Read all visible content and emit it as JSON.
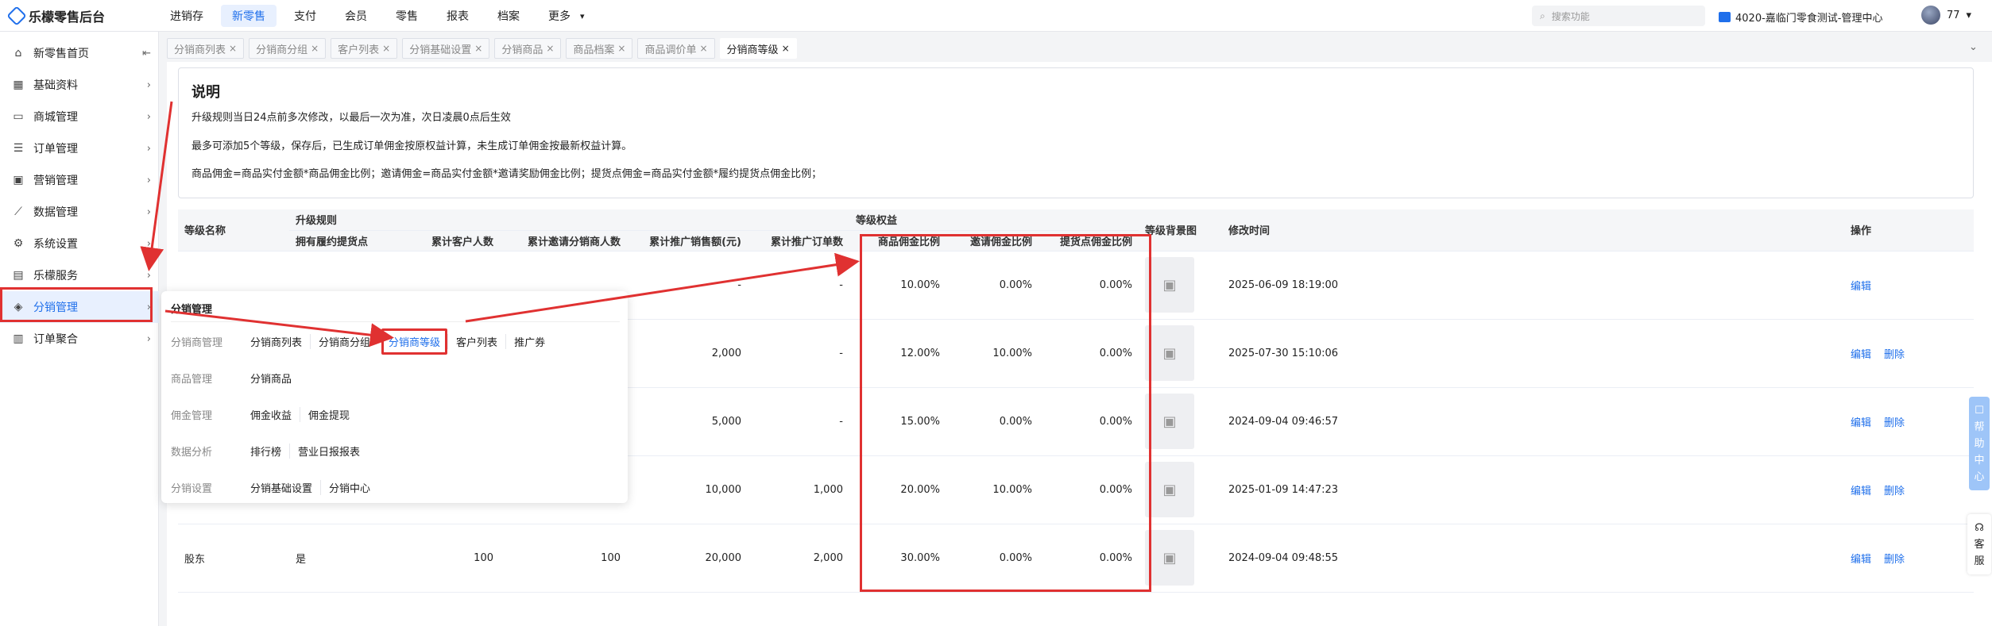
{
  "app": {
    "title": "乐檬零售后台"
  },
  "topnav": [
    "进销存",
    "新零售",
    "支付",
    "会员",
    "零售",
    "报表",
    "档案",
    "更多"
  ],
  "topnav_active_index": 1,
  "search": {
    "placeholder": "搜索功能"
  },
  "store": {
    "label": "4020-嘉临门零食测试-管理中心"
  },
  "user": {
    "name": "77"
  },
  "sidebar": {
    "collapse_icon": "collapse-icon",
    "items": [
      {
        "label": "新零售首页",
        "icon": "home-icon"
      },
      {
        "label": "基础资料",
        "icon": "grid-icon"
      },
      {
        "label": "商城管理",
        "icon": "store-icon"
      },
      {
        "label": "订单管理",
        "icon": "order-icon"
      },
      {
        "label": "营销管理",
        "icon": "marketing-icon"
      },
      {
        "label": "数据管理",
        "icon": "chart-icon"
      },
      {
        "label": "系统设置",
        "icon": "gear-icon"
      },
      {
        "label": "乐檬服务",
        "icon": "service-icon"
      },
      {
        "label": "分销管理",
        "icon": "distribution-icon"
      },
      {
        "label": "订单聚合",
        "icon": "aggregate-icon"
      }
    ],
    "active_index": 8
  },
  "tabs": [
    "分销商列表",
    "分销商分组",
    "客户列表",
    "分销基础设置",
    "分销商品",
    "商品档案",
    "商品调价单",
    "分销商等级"
  ],
  "active_tab_index": 7,
  "notice": {
    "title": "说明",
    "lines": [
      "升级规则当日24点前多次修改，以最后一次为准，次日凌晨0点后生效",
      "最多可添加5个等级，保存后，已生成订单佣金按原权益计算，未生成订单佣金按最新权益计算。",
      "商品佣金=商品实付金额*商品佣金比例；邀请佣金=商品实付金额*邀请奖励佣金比例；提货点佣金=商品实付金额*履约提货点佣金比例；"
    ]
  },
  "table": {
    "group_headers": {
      "upgrade": "升级规则",
      "benefits": "等级权益"
    },
    "headers": {
      "name": "等级名称",
      "has_pickup": "拥有履约提货点",
      "customers": "累计客户人数",
      "invited": "累计邀请分销商人数",
      "sales": "累计推广销售额(元)",
      "orders": "累计推广订单数",
      "goods_ratio": "商品佣金比例",
      "invite_ratio": "邀请佣金比例",
      "pickup_ratio": "提货点佣金比例",
      "bg_image": "等级背景图",
      "modified": "修改时间",
      "actions": "操作"
    },
    "rows": [
      {
        "name": "",
        "has_pickup": "",
        "customers": "",
        "invited": "",
        "sales": "-",
        "orders": "-",
        "goods_ratio": "10.00%",
        "invite_ratio": "0.00%",
        "pickup_ratio": "0.00%",
        "modified": "2025-06-09 18:19:00",
        "actions": [
          "编辑"
        ]
      },
      {
        "name": "",
        "has_pickup": "",
        "customers": "",
        "invited": "",
        "sales": "2,000",
        "orders": "-",
        "goods_ratio": "12.00%",
        "invite_ratio": "10.00%",
        "pickup_ratio": "0.00%",
        "modified": "2025-07-30 15:10:06",
        "actions": [
          "编辑",
          "删除"
        ]
      },
      {
        "name": "",
        "has_pickup": "",
        "customers": "",
        "invited": "",
        "sales": "5,000",
        "orders": "-",
        "goods_ratio": "15.00%",
        "invite_ratio": "0.00%",
        "pickup_ratio": "0.00%",
        "modified": "2024-09-04 09:46:57",
        "actions": [
          "编辑",
          "删除"
        ]
      },
      {
        "name": "",
        "has_pickup": "",
        "customers": "",
        "invited": "",
        "sales": "10,000",
        "orders": "1,000",
        "goods_ratio": "20.00%",
        "invite_ratio": "10.00%",
        "pickup_ratio": "0.00%",
        "modified": "2025-01-09 14:47:23",
        "actions": [
          "编辑",
          "删除"
        ]
      },
      {
        "name": "股东",
        "has_pickup": "是",
        "customers": "100",
        "invited": "100",
        "sales": "20,000",
        "orders": "2,000",
        "goods_ratio": "30.00%",
        "invite_ratio": "0.00%",
        "pickup_ratio": "0.00%",
        "modified": "2024-09-04 09:48:55",
        "actions": [
          "编辑",
          "删除"
        ]
      }
    ]
  },
  "popup": {
    "title": "分销管理",
    "rows": [
      {
        "category": "分销商管理",
        "links": [
          "分销商列表",
          "分销商分组",
          "分销商等级",
          "客户列表",
          "推广券"
        ],
        "highlight_index": 2
      },
      {
        "category": "商品管理",
        "links": [
          "分销商品"
        ]
      },
      {
        "category": "佣金管理",
        "links": [
          "佣金收益",
          "佣金提现"
        ]
      },
      {
        "category": "数据分析",
        "links": [
          "排行榜",
          "营业日报报表"
        ]
      },
      {
        "category": "分销设置",
        "links": [
          "分销基础设置",
          "分销中心"
        ]
      }
    ]
  },
  "help": {
    "chars": [
      "帮",
      "助",
      "中",
      "心"
    ]
  },
  "service": {
    "chars": [
      "客",
      "服"
    ]
  },
  "colors": {
    "accent": "#1f6feb",
    "annotation": "#e03131",
    "active_bg": "#e8f0fe"
  }
}
